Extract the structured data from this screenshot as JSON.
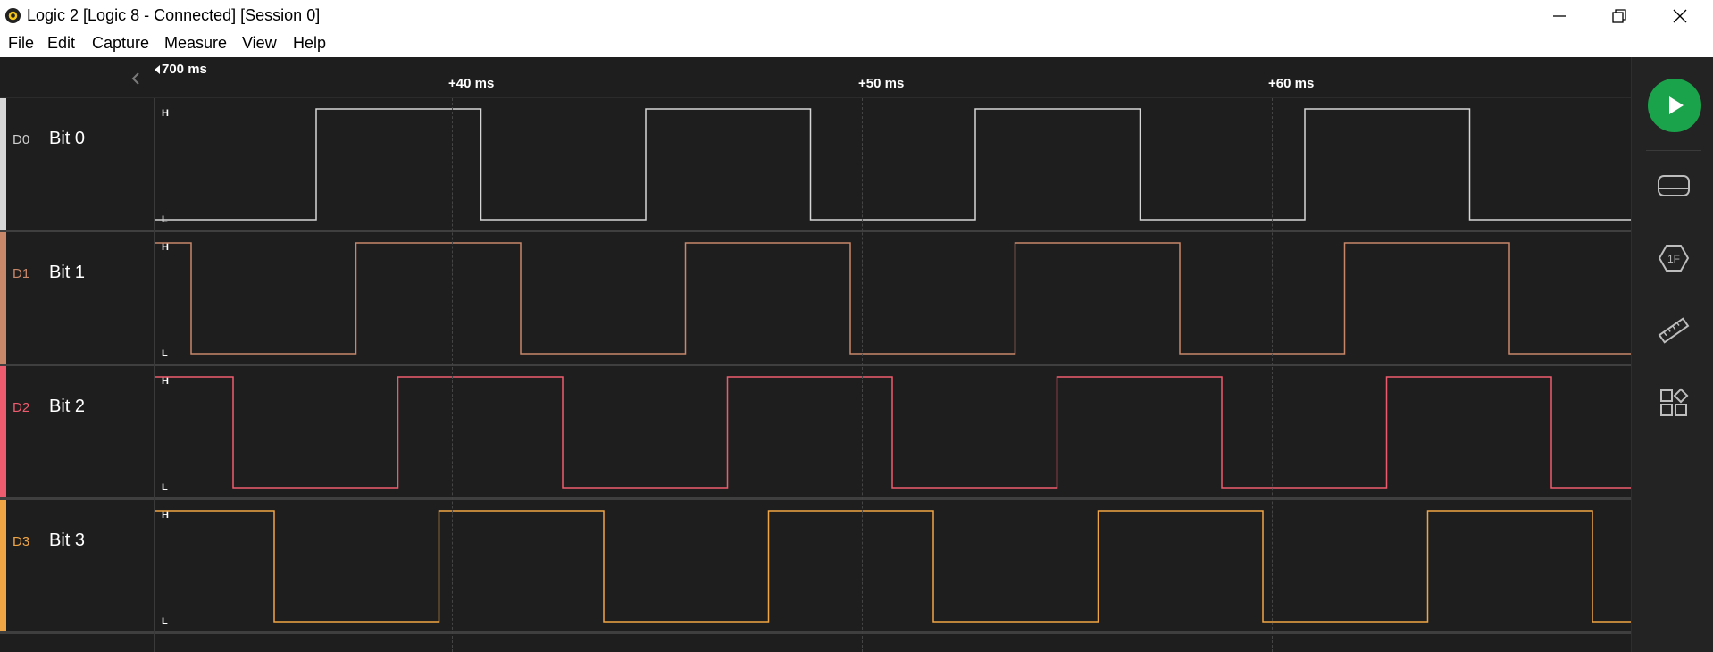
{
  "window": {
    "title": "Logic 2 [Logic 8 - Connected] [Session 0]",
    "controls": [
      "minimize",
      "restore",
      "close"
    ]
  },
  "menu": {
    "items": [
      "File",
      "Edit",
      "Capture",
      "Measure",
      "View",
      "Help"
    ]
  },
  "timeline": {
    "reference_time": "700 ms",
    "ticks": [
      "+40 ms",
      "+50 ms",
      "+60 ms"
    ]
  },
  "level_labels": {
    "high": "H",
    "low": "L"
  },
  "channels": [
    {
      "id": "D0",
      "name": "Bit 0",
      "color": "#d6d6d6",
      "initial_level": "L"
    },
    {
      "id": "D1",
      "name": "Bit 1",
      "color": "#c9876a",
      "initial_level": "H"
    },
    {
      "id": "D2",
      "name": "Bit 2",
      "color": "#ef5b6e",
      "initial_level": "H"
    },
    {
      "id": "D3",
      "name": "Bit 3",
      "color": "#f0a545",
      "initial_level": "H"
    }
  ],
  "sidebar": {
    "icons": [
      "play-icon",
      "analyzers-icon",
      "extensions-icon",
      "measurements-icon",
      "layout-icon"
    ],
    "accent": "#1aa34a"
  }
}
